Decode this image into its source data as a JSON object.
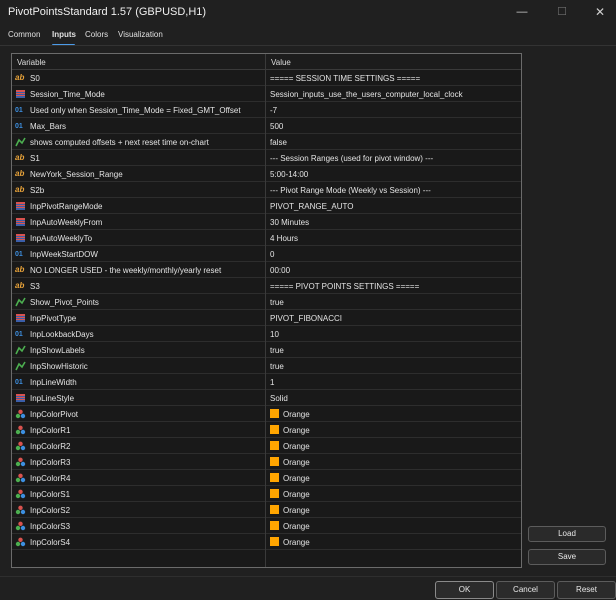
{
  "window": {
    "title": "PivotPointsStandard 1.57 (GBPUSD,H1)",
    "minimize": "—",
    "maximize": "☐",
    "close": "✕"
  },
  "tabs": [
    {
      "label": "Common",
      "active": false
    },
    {
      "label": "Inputs",
      "active": true
    },
    {
      "label": "Colors",
      "active": false
    },
    {
      "label": "Visualization",
      "active": false
    }
  ],
  "table": {
    "headers": {
      "variable": "Variable",
      "value": "Value"
    },
    "rows": [
      {
        "type": "string",
        "name": "S0",
        "value": "===== SESSION TIME SETTINGS ====="
      },
      {
        "type": "enum",
        "name": "Session_Time_Mode",
        "value": "Session_inputs_use_the_users_computer_local_clock"
      },
      {
        "type": "int",
        "name": "Used only when Session_Time_Mode = Fixed_GMT_Offset",
        "value": "-7"
      },
      {
        "type": "int",
        "name": "Max_Bars",
        "value": "500"
      },
      {
        "type": "bool",
        "name": "shows computed offsets + next reset time on-chart",
        "value": "false"
      },
      {
        "type": "string",
        "name": "S1",
        "value": "--- Session Ranges (used for pivot window) ---"
      },
      {
        "type": "string",
        "name": "NewYork_Session_Range",
        "value": "5:00-14:00"
      },
      {
        "type": "string",
        "name": "S2b",
        "value": "--- Pivot Range Mode (Weekly vs Session) ---"
      },
      {
        "type": "enum",
        "name": "InpPivotRangeMode",
        "value": "PIVOT_RANGE_AUTO"
      },
      {
        "type": "enum",
        "name": "InpAutoWeeklyFrom",
        "value": "30 Minutes"
      },
      {
        "type": "enum",
        "name": "InpAutoWeeklyTo",
        "value": "4 Hours"
      },
      {
        "type": "int",
        "name": "InpWeekStartDOW",
        "value": "0"
      },
      {
        "type": "string",
        "name": "NO LONGER USED - the weekly/monthly/yearly reset",
        "value": "00:00"
      },
      {
        "type": "string",
        "name": "S3",
        "value": "===== PIVOT POINTS SETTINGS ====="
      },
      {
        "type": "bool",
        "name": "Show_Pivot_Points",
        "value": "true"
      },
      {
        "type": "enum",
        "name": "InpPivotType",
        "value": "PIVOT_FIBONACCI"
      },
      {
        "type": "int",
        "name": "InpLookbackDays",
        "value": "10"
      },
      {
        "type": "bool",
        "name": "InpShowLabels",
        "value": "true"
      },
      {
        "type": "bool",
        "name": "InpShowHistoric",
        "value": "true"
      },
      {
        "type": "int",
        "name": "InpLineWidth",
        "value": "1"
      },
      {
        "type": "enum",
        "name": "InpLineStyle",
        "value": "Solid"
      },
      {
        "type": "color",
        "name": "InpColorPivot",
        "value": "Orange",
        "color": "#FFA500"
      },
      {
        "type": "color",
        "name": "InpColorR1",
        "value": "Orange",
        "color": "#FFA500"
      },
      {
        "type": "color",
        "name": "InpColorR2",
        "value": "Orange",
        "color": "#FFA500"
      },
      {
        "type": "color",
        "name": "InpColorR3",
        "value": "Orange",
        "color": "#FFA500"
      },
      {
        "type": "color",
        "name": "InpColorR4",
        "value": "Orange",
        "color": "#FFA500"
      },
      {
        "type": "color",
        "name": "InpColorS1",
        "value": "Orange",
        "color": "#FFA500"
      },
      {
        "type": "color",
        "name": "InpColorS2",
        "value": "Orange",
        "color": "#FFA500"
      },
      {
        "type": "color",
        "name": "InpColorS3",
        "value": "Orange",
        "color": "#FFA500"
      },
      {
        "type": "color",
        "name": "InpColorS4",
        "value": "Orange",
        "color": "#FFA500"
      }
    ]
  },
  "side_buttons": {
    "load": "Load",
    "save": "Save"
  },
  "bottom_buttons": {
    "ok": "OK",
    "cancel": "Cancel",
    "reset": "Reset"
  },
  "colors": {
    "background": "#202020",
    "grid": "#191919",
    "accent": "#4C9BE8",
    "string_icon": "#E8A33A",
    "int_icon": "#3D8FE0",
    "bool_icon": "#4CAF50",
    "enum_icon": "#D9534F",
    "swatch": "#FFA500"
  }
}
